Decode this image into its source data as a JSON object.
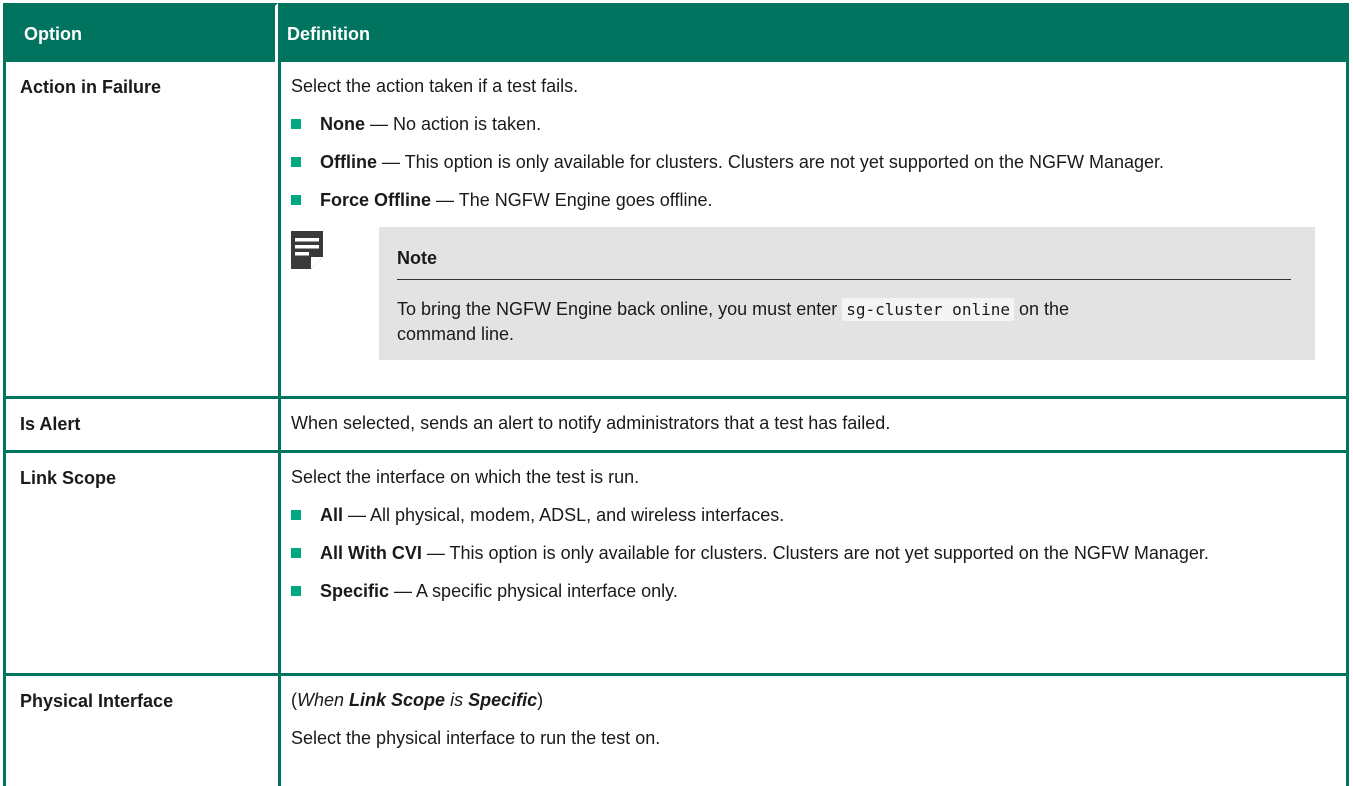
{
  "header": {
    "option": "Option",
    "definition": "Definition"
  },
  "rows": {
    "action_in_failure": {
      "option": "Action in Failure",
      "intro": "Select the action taken if a test fails.",
      "items": [
        {
          "term": "None",
          "text": " — No action is taken."
        },
        {
          "term": "Offline",
          "text": " — This option is only available for clusters. Clusters are not yet supported on the NGFW Manager."
        },
        {
          "term": "Force Offline",
          "text": " — The NGFW Engine goes offline."
        }
      ],
      "note": {
        "icon": "note-icon",
        "title": "Note",
        "text_before": "To bring the NGFW Engine back online, you must enter ",
        "code": "sg-cluster online",
        "text_after": " on the command line."
      }
    },
    "is_alert": {
      "option": "Is Alert",
      "text": "When selected, sends an alert to notify administrators that a test has failed."
    },
    "link_scope": {
      "option": "Link Scope",
      "intro": "Select the interface on which the test is run.",
      "items": [
        {
          "term": "All",
          "text": " — All physical, modem, ADSL, and wireless interfaces."
        },
        {
          "term": "All With CVI",
          "text": " — This option is only available for clusters. Clusters are not yet supported on the NGFW Manager."
        },
        {
          "term": "Specific",
          "text": " — A specific physical interface only."
        }
      ]
    },
    "physical_interface": {
      "option": "Physical Interface",
      "condition_open": "(",
      "condition_when": "When ",
      "condition_field": "Link Scope",
      "condition_is": " is ",
      "condition_value": "Specific",
      "condition_close": ")",
      "text": "Select the physical interface to run the test on."
    }
  },
  "colors": {
    "header_bg": "#01745f",
    "bullet": "#01a982",
    "note_bg": "#e3e3e3"
  }
}
